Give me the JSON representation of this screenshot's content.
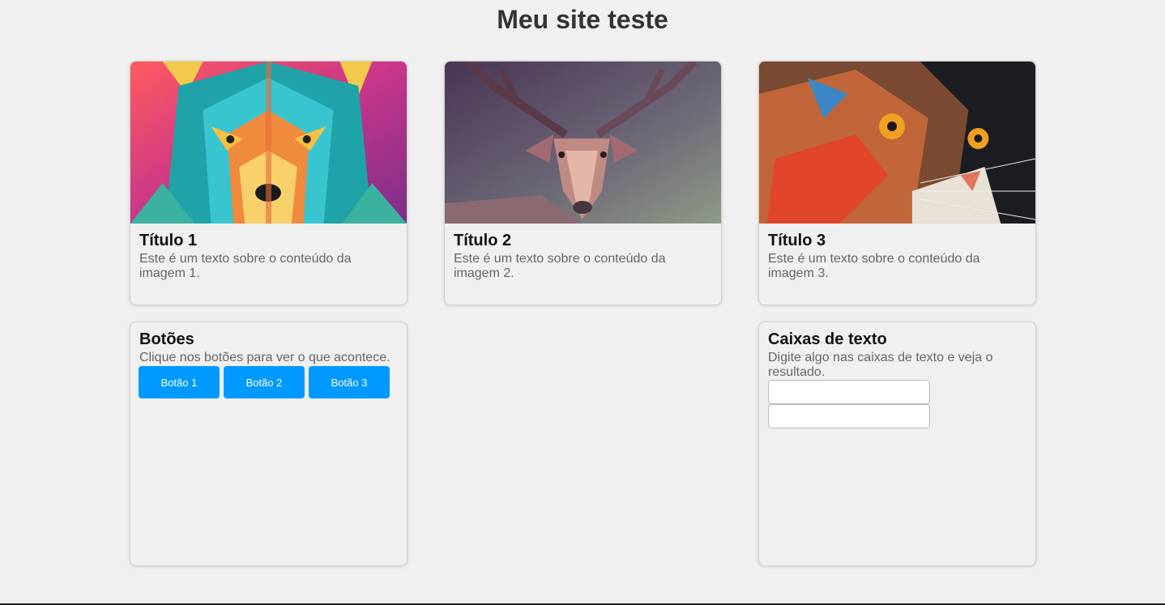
{
  "page": {
    "title": "Meu site teste"
  },
  "cards": [
    {
      "title": "Título 1",
      "text": "Este é um texto sobre o conteúdo da imagem 1.",
      "image": "wolf-art"
    },
    {
      "title": "Título 2",
      "text": "Este é um texto sobre o conteúdo da imagem 2.",
      "image": "deer-art"
    },
    {
      "title": "Título 3",
      "text": "Este é um texto sobre o conteúdo da imagem 3.",
      "image": "cat-art"
    }
  ],
  "buttons_panel": {
    "title": "Botões",
    "text": "Clique nos botões para ver o que acontece.",
    "buttons": [
      "Botão 1",
      "Botão 2",
      "Botão 3"
    ],
    "button_color": "#0099ff"
  },
  "textbox_panel": {
    "title": "Caixas de texto",
    "text": "Digite algo nas caixas de texto e veja o resultado.",
    "inputs": [
      {
        "value": ""
      },
      {
        "value": ""
      }
    ]
  }
}
